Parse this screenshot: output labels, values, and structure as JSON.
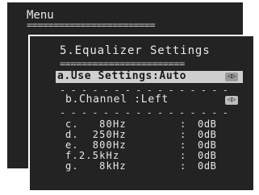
{
  "back_menu": {
    "title": "Menu",
    "rule": "========================"
  },
  "panel": {
    "title": "5.Equalizer Settings",
    "rule_double": "=======================",
    "rule_dash": "- - - - - - - - - - - - - - - -",
    "selected_item": "a.Use Settings:Auto",
    "channel_item": "b.Channel :Left",
    "arrow_icon": "◁▷",
    "bands": [
      {
        "label": "c.   80Hz",
        "sep": ":",
        "value": "0dB"
      },
      {
        "label": "d.  250Hz",
        "sep": ":",
        "value": "0dB"
      },
      {
        "label": "e.  800Hz",
        "sep": ":",
        "value": "0dB"
      },
      {
        "label": "f.2.5kHz",
        "sep": ":",
        "value": "0dB"
      },
      {
        "label": "g.   8kHz",
        "sep": ":",
        "value": "0dB"
      }
    ]
  }
}
